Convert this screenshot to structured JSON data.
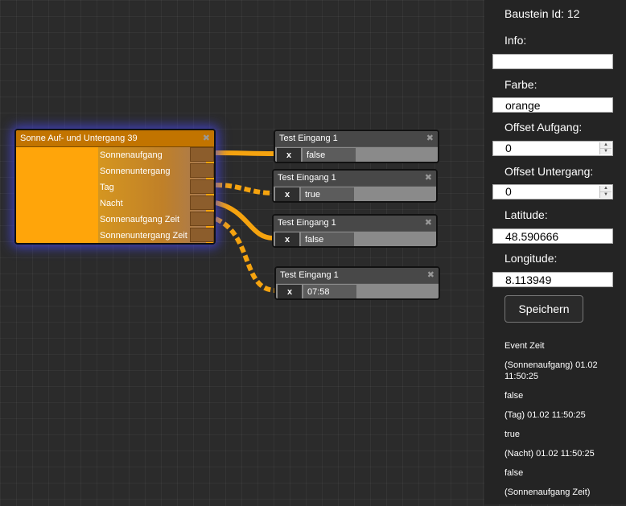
{
  "source_node": {
    "title": "Sonne Auf- und Untergang 39",
    "close": "✖",
    "color": "#ffa50a",
    "outputs": [
      "Sonnenaufgang",
      "Sonnenuntergang",
      "Tag",
      "Nacht",
      "Sonnenaufgang Zeit",
      "Sonnenuntergang Zeit"
    ]
  },
  "target_nodes": [
    {
      "title": "Test Eingang 1",
      "close": "✖",
      "x_label": "x",
      "value": "false"
    },
    {
      "title": "Test Eingang 1",
      "close": "✖",
      "x_label": "x",
      "value": "true"
    },
    {
      "title": "Test Eingang 1",
      "close": "✖",
      "x_label": "x",
      "value": "false"
    },
    {
      "title": "Test Eingang 1",
      "close": "✖",
      "x_label": "x",
      "value": "07:58"
    }
  ],
  "wire_color": "#f5a30f",
  "sidebar": {
    "title": "Baustein Id: 12",
    "info_label": "Info:",
    "info_value": "",
    "farbe_label": "Farbe:",
    "farbe_value": "orange",
    "offset_aufgang_label": "Offset Aufgang:",
    "offset_aufgang_value": "0",
    "offset_untergang_label": "Offset Untergang:",
    "offset_untergang_value": "0",
    "latitude_label": "Latitude:",
    "latitude_value": "48.590666",
    "longitude_label": "Longitude:",
    "longitude_value": "8.113949",
    "save_label": "Speichern",
    "events": [
      "Event Zeit",
      "(Sonnenaufgang) 01.02 11:50:25",
      "false",
      "(Tag) 01.02 11:50:25",
      "true",
      "(Nacht) 01.02 11:50:25",
      "false",
      "(Sonnenaufgang Zeit)"
    ]
  }
}
